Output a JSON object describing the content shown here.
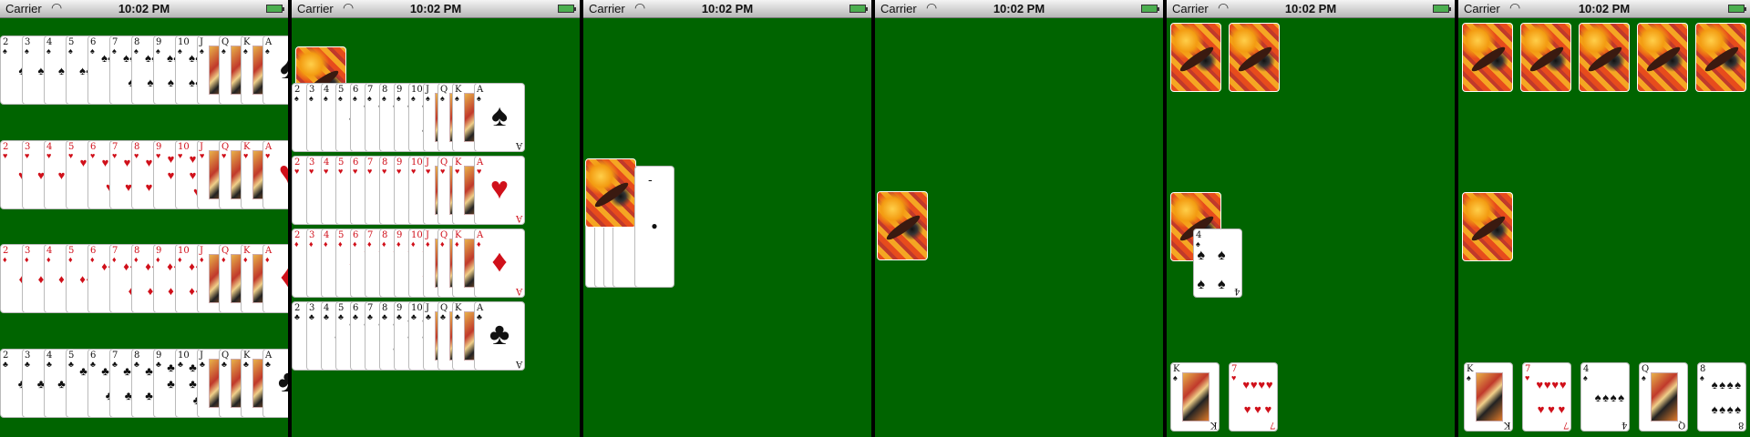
{
  "status_bar": {
    "carrier": "Carrier",
    "time": "10:02 PM"
  },
  "panels": [
    {
      "name": "panel-1-full-deck",
      "rows": [
        {
          "suit": "spades",
          "symbol": "♠",
          "color": "#111111",
          "ranks": [
            "2",
            "3",
            "4",
            "5",
            "6",
            "7",
            "8",
            "9",
            "10",
            "J",
            "Q",
            "K",
            "A"
          ]
        },
        {
          "suit": "hearts",
          "symbol": "♥",
          "color": "#d0101a",
          "ranks": [
            "2",
            "3",
            "4",
            "5",
            "6",
            "7",
            "8",
            "9",
            "10",
            "J",
            "Q",
            "K",
            "A"
          ]
        },
        {
          "suit": "diamonds",
          "symbol": "♦",
          "color": "#d0101a",
          "ranks": [
            "2",
            "3",
            "4",
            "5",
            "6",
            "7",
            "8",
            "9",
            "10",
            "J",
            "Q",
            "K",
            "A"
          ]
        },
        {
          "suit": "clubs",
          "symbol": "♣",
          "color": "#111111",
          "ranks": [
            "2",
            "3",
            "4",
            "5",
            "6",
            "7",
            "8",
            "9",
            "10",
            "J",
            "Q",
            "K",
            "A"
          ]
        }
      ]
    },
    {
      "name": "panel-2-deck-with-back",
      "rows": [
        {
          "suit": "spades",
          "symbol": "♠",
          "color": "#111111",
          "ranks": [
            "2",
            "3",
            "4",
            "5",
            "6",
            "7",
            "8",
            "9",
            "10",
            "J",
            "Q",
            "K",
            "A"
          ]
        },
        {
          "suit": "hearts",
          "symbol": "♥",
          "color": "#d0101a",
          "ranks": [
            "2",
            "3",
            "4",
            "5",
            "6",
            "7",
            "8",
            "9",
            "10",
            "J",
            "Q",
            "K",
            "A"
          ]
        },
        {
          "suit": "diamonds",
          "symbol": "♦",
          "color": "#d0101a",
          "ranks": [
            "2",
            "3",
            "4",
            "5",
            "6",
            "7",
            "8",
            "9",
            "10",
            "J",
            "Q",
            "K",
            "A"
          ]
        },
        {
          "suit": "clubs",
          "symbol": "♣",
          "color": "#111111",
          "ranks": [
            "2",
            "3",
            "4",
            "5",
            "6",
            "7",
            "8",
            "9",
            "10",
            "J",
            "Q",
            "K",
            "A"
          ]
        }
      ]
    },
    {
      "name": "panel-3-stacked-pile",
      "top_card": {
        "rank": "A",
        "symbol": "♣"
      }
    },
    {
      "name": "panel-4-single-back"
    },
    {
      "name": "panel-5-deal",
      "middle_card": {
        "rank": "4",
        "symbol": "♠"
      },
      "bottom_cards": [
        {
          "rank": "K",
          "symbol": "♠"
        },
        {
          "rank": "7",
          "symbol": "♥"
        }
      ]
    },
    {
      "name": "panel-6-deal",
      "bottom_cards": [
        {
          "rank": "K",
          "symbol": "♠"
        },
        {
          "rank": "7",
          "symbol": "♥"
        },
        {
          "rank": "4",
          "symbol": "♠"
        },
        {
          "rank": "Q",
          "symbol": "♠"
        },
        {
          "rank": "8",
          "symbol": "♠"
        }
      ]
    }
  ],
  "colors": {
    "table": "#006400",
    "red": "#d0101a",
    "black": "#111111"
  }
}
